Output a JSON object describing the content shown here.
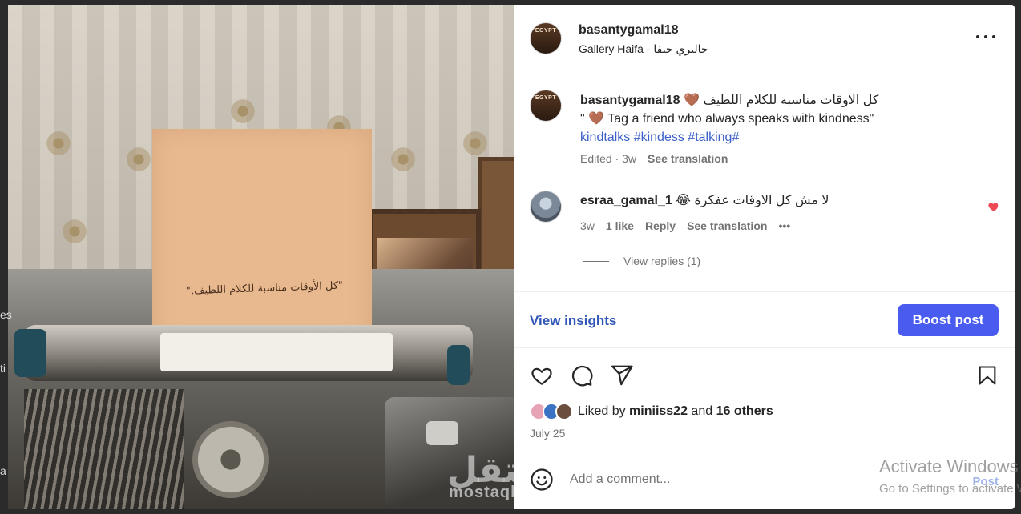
{
  "photo": {
    "paper_text": "\"كل الأوقات مناسبة للكلام اللطيف.\"",
    "left_edge_chars": [
      "es",
      "ti",
      "a"
    ]
  },
  "watermark": {
    "main": "مستقل",
    "sub": "mostaql.com"
  },
  "post": {
    "username": "basantygamal18",
    "location": "Gallery Haifa - جاليري حيفا",
    "avatar_text": "EGYPT",
    "more_icon": "more-horizontal-icon"
  },
  "caption": {
    "username": "basantygamal18",
    "arabic_text": "كل الاوقات مناسبة للكلام اللطيف",
    "heart_emoji": "🤎",
    "line2_prefix": "\"",
    "line2_text": " Tag a friend who always speaks with kindness\"",
    "hashtags": "kindtalks #kindess #talking#",
    "edited": "Edited · 3w",
    "see_translation": "See translation"
  },
  "comment": {
    "username": "esraa_gamal_1",
    "emoji": "😂",
    "text": "لا مش كل الاوقات عفكرة",
    "time": "3w",
    "likes": "1 like",
    "reply": "Reply",
    "see_translation": "See translation",
    "options": "•••",
    "view_replies": "View replies (1)",
    "liked": true
  },
  "insights": {
    "view_insights": "View insights",
    "boost_post": "Boost post"
  },
  "engagement": {
    "liked_by_prefix": "Liked by ",
    "liked_by_user": "miniiss22",
    "and_text": " and ",
    "others": "16 others",
    "date": "July 25"
  },
  "compose": {
    "placeholder": "Add a comment...",
    "post_label": "Post"
  },
  "windows": {
    "activate_title": "Activate Windows",
    "activate_sub": "Go to Settings to activate Windows."
  },
  "colors": {
    "accent_blue": "#4a5cf0",
    "link_blue": "#2f56b8",
    "hashtag_blue": "#3a5fc8",
    "like_red": "#ed4956"
  }
}
